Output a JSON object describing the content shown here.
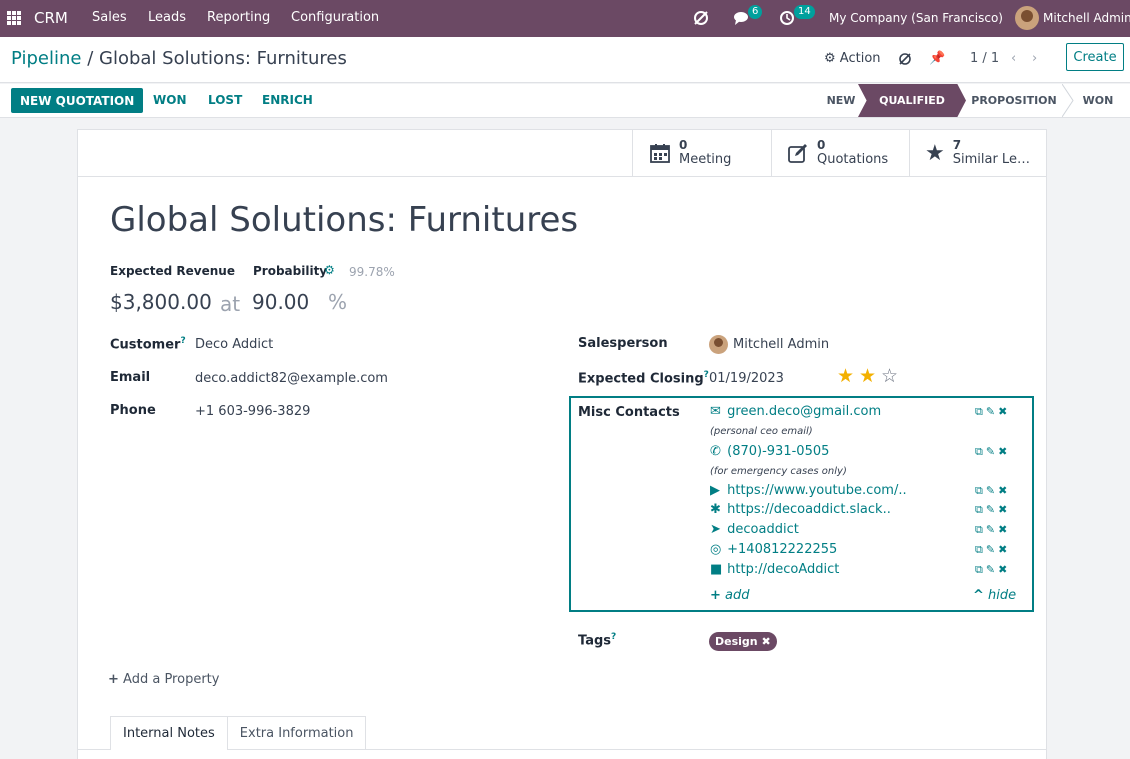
{
  "topbar": {
    "app_name": "CRM",
    "menu": [
      "Sales",
      "Leads",
      "Reporting",
      "Configuration"
    ],
    "messages_count": "6",
    "activities_count": "14",
    "company": "My Company (San Francisco)",
    "user": "Mitchell Admin"
  },
  "control_panel": {
    "breadcrumb_parent": "Pipeline",
    "breadcrumb_separator": "/",
    "breadcrumb_current": "Global Solutions: Furnitures",
    "action_label": "Action",
    "pager": "1 / 1",
    "create_label": "Create"
  },
  "statusbar": {
    "buttons": [
      "NEW QUOTATION",
      "WON",
      "LOST",
      "ENRICH"
    ],
    "stages": [
      "NEW",
      "QUALIFIED",
      "PROPOSITION",
      "WON"
    ],
    "active_stage": "QUALIFIED"
  },
  "smart_buttons": [
    {
      "count": "0",
      "label": "Meeting",
      "icon": "calendar-icon"
    },
    {
      "count": "0",
      "label": "Quotations",
      "icon": "edit-icon"
    },
    {
      "count": "7",
      "label": "Similar Le…",
      "icon": "star-icon"
    }
  ],
  "record": {
    "title": "Global Solutions: Furnitures",
    "expected_revenue_label": "Expected Revenue",
    "probability_label": "Probability",
    "probability_auto": "99.78%",
    "revenue": "$3,800.00",
    "at": "at",
    "probability": "90.00",
    "percent": "%",
    "customer_label": "Customer",
    "customer": "Deco Addict",
    "email_label": "Email",
    "email": "deco.addict82@example.com",
    "phone_label": "Phone",
    "phone": "+1 603-996-3829",
    "salesperson_label": "Salesperson",
    "salesperson": "Mitchell Admin",
    "closing_label": "Expected Closing",
    "closing": "01/19/2023",
    "priority_stars": 2,
    "priority_max": 3,
    "misc_label": "Misc Contacts",
    "tags_label": "Tags",
    "tag": "Design",
    "add_property": "Add a Property",
    "tooltip_mark": "?"
  },
  "misc_contacts": [
    {
      "icon": "envelope-icon",
      "glyph": "✉",
      "value": "green.deco@gmail.com",
      "note": "(personal ceo email)"
    },
    {
      "icon": "phone-icon",
      "glyph": "✆",
      "value": "(870)-931-0505",
      "note": "(for emergency cases only)"
    },
    {
      "icon": "youtube-icon",
      "glyph": "▶",
      "value": "https://www.youtube.com/..",
      "note": ""
    },
    {
      "icon": "slack-icon",
      "glyph": "✱",
      "value": "https://decoaddict.slack..",
      "note": ""
    },
    {
      "icon": "telegram-icon",
      "glyph": "➤",
      "value": "decoaddict",
      "note": ""
    },
    {
      "icon": "whatsapp-icon",
      "glyph": "◎",
      "value": "+140812222255",
      "note": ""
    },
    {
      "icon": "video-icon",
      "glyph": "■",
      "value": "http://decoAddict",
      "note": ""
    }
  ],
  "misc_footer": {
    "add": "add",
    "hide": "hide"
  },
  "tabs": [
    "Internal Notes",
    "Extra Information"
  ],
  "colors": {
    "brand": "#6b4964",
    "accent": "#017e84",
    "star": "#f3b000"
  }
}
